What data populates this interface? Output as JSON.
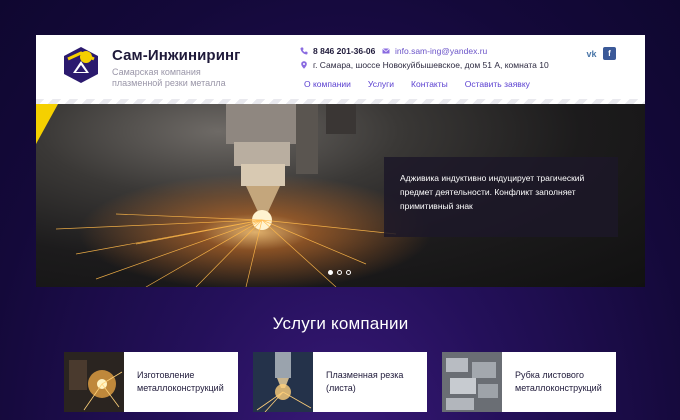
{
  "brand": {
    "name": "Сам-Инжиниринг",
    "tagline": "Самарская компания плазменной резки металла"
  },
  "contacts": {
    "phone": "8 846 201-36-06",
    "email": "info.sam-ing@yandex.ru",
    "address": "г. Самара, шоссе Новокуйбышевское, дом 51 А, комната 10"
  },
  "nav": {
    "items": [
      {
        "label": "О компании"
      },
      {
        "label": "Услуги"
      },
      {
        "label": "Контакты"
      },
      {
        "label": "Оставить заявку"
      }
    ]
  },
  "social": {
    "vk": "vk",
    "fb": "f"
  },
  "hero": {
    "caption": "Адживика индуктивно индуцирует трагический предмет деятельности. Конфликт заполняет примитивный знак",
    "slides": 3,
    "active_slide": 1
  },
  "services": {
    "title": "Услуги компании",
    "items": [
      {
        "label": "Изготовление металлоконструкций",
        "icon": "welding-photo"
      },
      {
        "label": "Плазменная резка (листа)",
        "icon": "plasma-cutting-photo"
      },
      {
        "label": "Рубка листового металлоконструкций",
        "icon": "sheet-metal-photo"
      }
    ]
  },
  "colors": {
    "accent": "#5a3fd0",
    "brand_dark": "#1f1a3a",
    "highlight_yellow": "#f5d000",
    "background": "#1a0c45"
  }
}
